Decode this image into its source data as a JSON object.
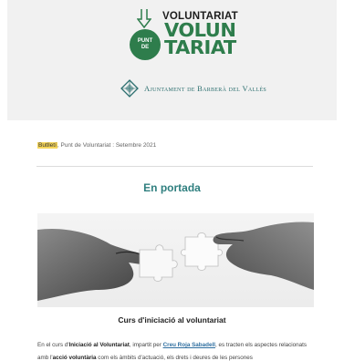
{
  "header": {
    "logo_top": "VOLUNTARIAT",
    "logo_badge_line1": "PUNT",
    "logo_badge_line2": "DE",
    "logo_big_line1": "VOLUN",
    "logo_big_line2": "TARIAT",
    "ajuntament": "Ajuntament de Barberà del Vallès"
  },
  "meta": {
    "tag": "Butlletí",
    "rest": ", Punt de Voluntariat : Setembre 2021"
  },
  "section_title": "En portada",
  "article": {
    "title": "Curs d'iniciació al voluntariat",
    "p_intro": "En el curs d'",
    "p_bold1": "Iniciació al Voluntariat",
    "p_mid1": ", impartit per ",
    "p_link": "Creu Roja Sabadell",
    "p_mid2": ", es tracten els aspectes relacionats amb l'",
    "p_bold2": "acció voluntària",
    "p_end": " com els àmbits d'actuació, els drets i deures de les persones"
  },
  "colors": {
    "brand_green": "#2e7d4c",
    "teal": "#2f7f7f",
    "highlight": "#f6d65a",
    "link": "#2f6fa0"
  },
  "icons": [
    "arrow-down-icon",
    "ajuntament-shield-icon"
  ]
}
